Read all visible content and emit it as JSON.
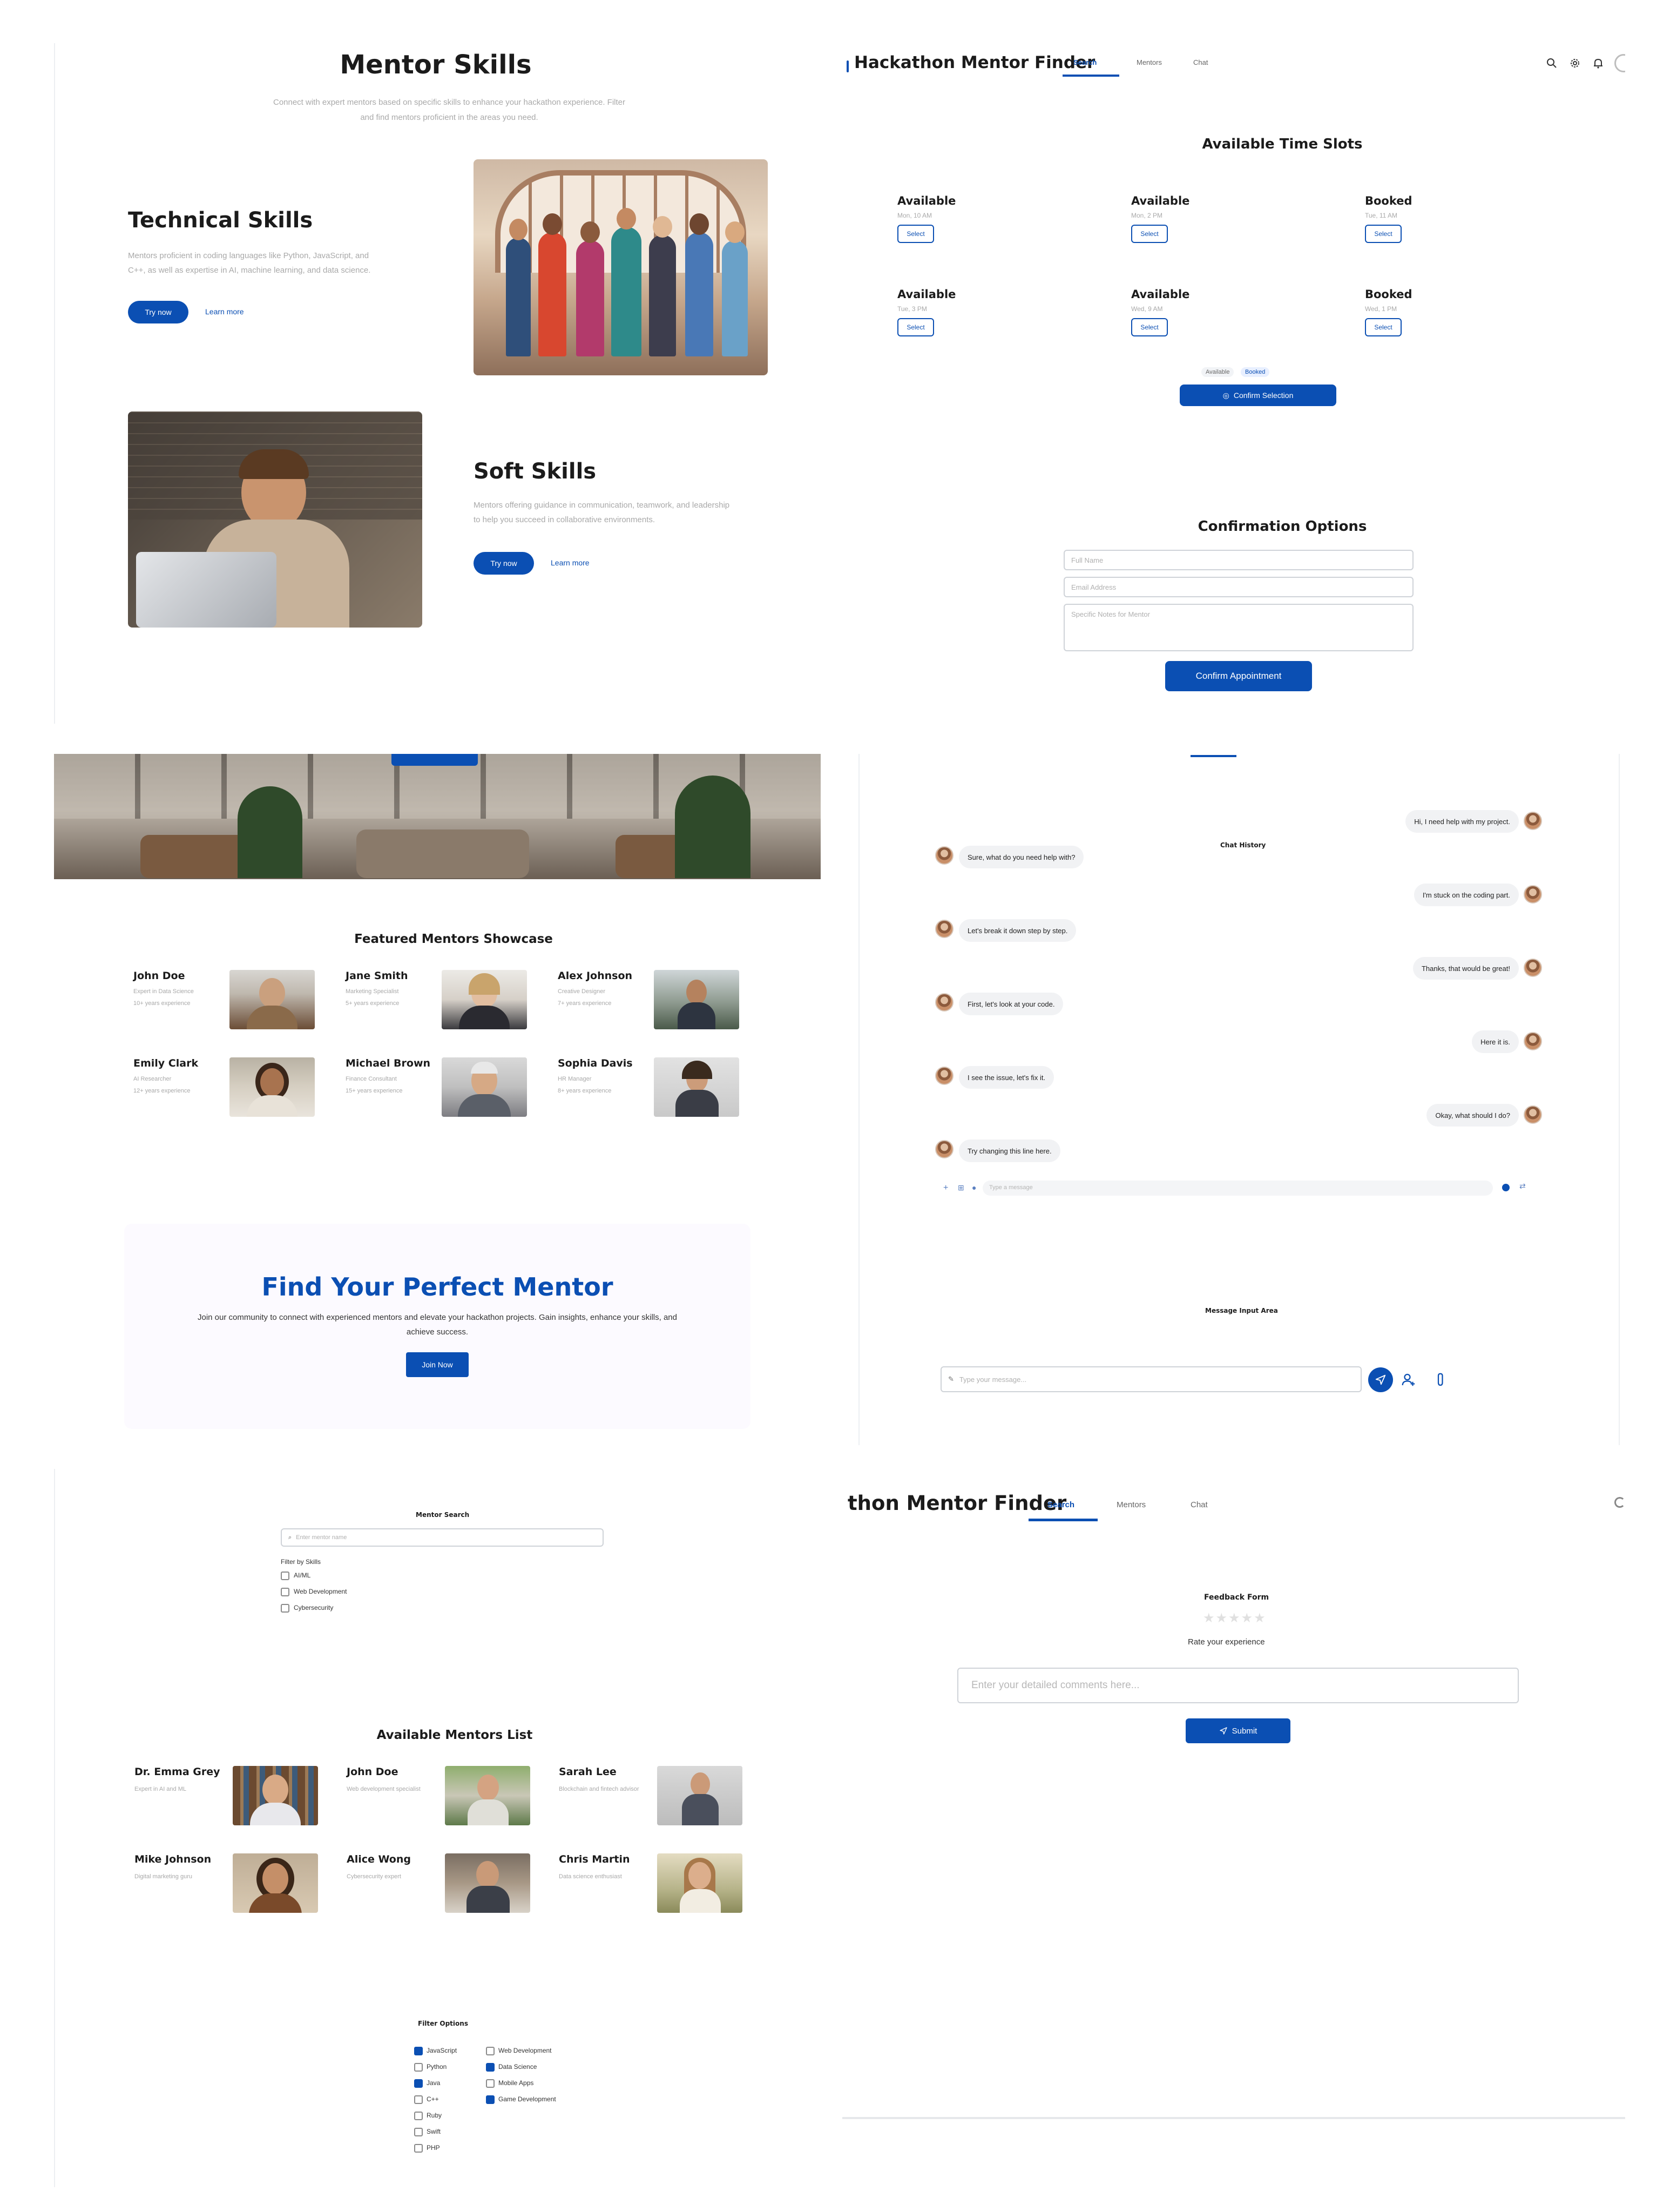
{
  "mentor_skills": {
    "title": "Mentor Skills",
    "subtitle": "Connect with expert mentors based on specific skills to enhance your hackathon experience. Filter and find mentors proficient in the areas you need.",
    "technical": {
      "title": "Technical Skills",
      "description": "Mentors proficient in coding languages like Python, JavaScript, and C++, as well as expertise in AI, machine learning, and data science.",
      "try_label": "Try now",
      "learn_label": "Learn more"
    },
    "soft": {
      "title": "Soft Skills",
      "description": "Mentors offering guidance in communication, teamwork, and leadership to help you succeed in collaborative environments.",
      "try_label": "Try now",
      "learn_label": "Learn more"
    }
  },
  "header_top": {
    "app_title": "Hackathon Mentor Finder",
    "tabs": [
      "Search",
      "Mentors",
      "Chat"
    ],
    "active_tab": "Search",
    "icons": [
      "search-icon",
      "gear-icon",
      "bell-icon",
      "avatar"
    ]
  },
  "time_slots": {
    "title": "Available Time Slots",
    "slots": [
      {
        "status": "Available",
        "time": "Mon, 10 AM",
        "button": "Select"
      },
      {
        "status": "Available",
        "time": "Mon, 2 PM",
        "button": "Select"
      },
      {
        "status": "Booked",
        "time": "Tue, 11 AM",
        "button": "Select"
      },
      {
        "status": "Available",
        "time": "Tue, 3 PM",
        "button": "Select"
      },
      {
        "status": "Available",
        "time": "Wed, 9 AM",
        "button": "Select"
      },
      {
        "status": "Booked",
        "time": "Wed, 1 PM",
        "button": "Select"
      }
    ],
    "legend": [
      "Available",
      "Booked"
    ],
    "confirm_label": "Confirm Selection"
  },
  "confirmation": {
    "title": "Confirmation Options",
    "name_placeholder": "Full Name",
    "email_placeholder": "Email Address",
    "notes_placeholder": "Specific Notes for Mentor",
    "button": "Confirm Appointment"
  },
  "featured": {
    "title": "Featured Mentors Showcase",
    "mentors": [
      {
        "name": "John Doe",
        "role": "Expert in Data Science",
        "exp": "10+ years experience"
      },
      {
        "name": "Jane Smith",
        "role": "Marketing Specialist",
        "exp": "5+ years experience"
      },
      {
        "name": "Alex Johnson",
        "role": "Creative Designer",
        "exp": "7+ years experience"
      },
      {
        "name": "Emily Clark",
        "role": "AI Researcher",
        "exp": "12+ years experience"
      },
      {
        "name": "Michael Brown",
        "role": "Finance Consultant",
        "exp": "15+ years experience"
      },
      {
        "name": "Sophia Davis",
        "role": "HR Manager",
        "exp": "8+ years experience"
      }
    ]
  },
  "cta": {
    "title": "Find Your Perfect Mentor",
    "text": "Join our community to connect with experienced mentors and elevate your hackathon projects. Gain insights, enhance your skills, and achieve success.",
    "button": "Join Now"
  },
  "chat": {
    "history_title": "Chat History",
    "messages": [
      {
        "side": "right",
        "text": "Hi, I need help with my project."
      },
      {
        "side": "left",
        "text": "Sure, what do you need help with?"
      },
      {
        "side": "right",
        "text": "I'm stuck on the coding part."
      },
      {
        "side": "left",
        "text": "Let's break it down step by step."
      },
      {
        "side": "right",
        "text": "Thanks, that would be great!"
      },
      {
        "side": "left",
        "text": "First, let's look at your code."
      },
      {
        "side": "right",
        "text": "Here it is."
      },
      {
        "side": "left",
        "text": "I see the issue, let's fix it."
      },
      {
        "side": "right",
        "text": "Okay, what should I do?"
      },
      {
        "side": "left",
        "text": "Try changing this line here."
      }
    ],
    "composer_placeholder": "Type a message",
    "input_area_title": "Message Input Area",
    "input_placeholder": "Type your message..."
  },
  "search": {
    "title": "Mentor Search",
    "placeholder": "Enter mentor name",
    "filter_label": "Filter by Skills",
    "skills": [
      "AI/ML",
      "Web Development",
      "Cybersecurity"
    ]
  },
  "mentor_list": {
    "title": "Available Mentors List",
    "mentors": [
      {
        "name": "Dr. Emma Grey",
        "desc": "Expert in AI and ML"
      },
      {
        "name": "John Doe",
        "desc": "Web development specialist"
      },
      {
        "name": "Sarah Lee",
        "desc": "Blockchain and fintech advisor"
      },
      {
        "name": "Mike Johnson",
        "desc": "Digital marketing guru"
      },
      {
        "name": "Alice Wong",
        "desc": "Cybersecurity expert"
      },
      {
        "name": "Chris Martin",
        "desc": "Data science enthusiast"
      }
    ]
  },
  "filter_options": {
    "title": "Filter Options",
    "left": [
      {
        "label": "JavaScript",
        "checked": true
      },
      {
        "label": "Python",
        "checked": false
      },
      {
        "label": "Java",
        "checked": true
      },
      {
        "label": "C++",
        "checked": false
      },
      {
        "label": "Ruby",
        "checked": false
      },
      {
        "label": "Swift",
        "checked": false
      },
      {
        "label": "PHP",
        "checked": false
      }
    ],
    "right": [
      {
        "label": "Web Development",
        "checked": false
      },
      {
        "label": "Data Science",
        "checked": true
      },
      {
        "label": "Mobile Apps",
        "checked": false
      },
      {
        "label": "Game Development",
        "checked": true
      }
    ]
  },
  "header_bottom": {
    "app_title": "thon Mentor Finder",
    "tabs": [
      "Search",
      "Mentors",
      "Chat"
    ],
    "active_tab": "Search"
  },
  "feedback": {
    "title": "Feedback Form",
    "stars": 5,
    "rate_label": "Rate your experience",
    "comments_placeholder": "Enter your detailed comments here...",
    "submit": "Submit"
  },
  "colors": {
    "accent": "#0b4fb3",
    "text": "#1b1b1b",
    "muted": "#a9a9a9",
    "bubble": "#f1f2f4"
  }
}
